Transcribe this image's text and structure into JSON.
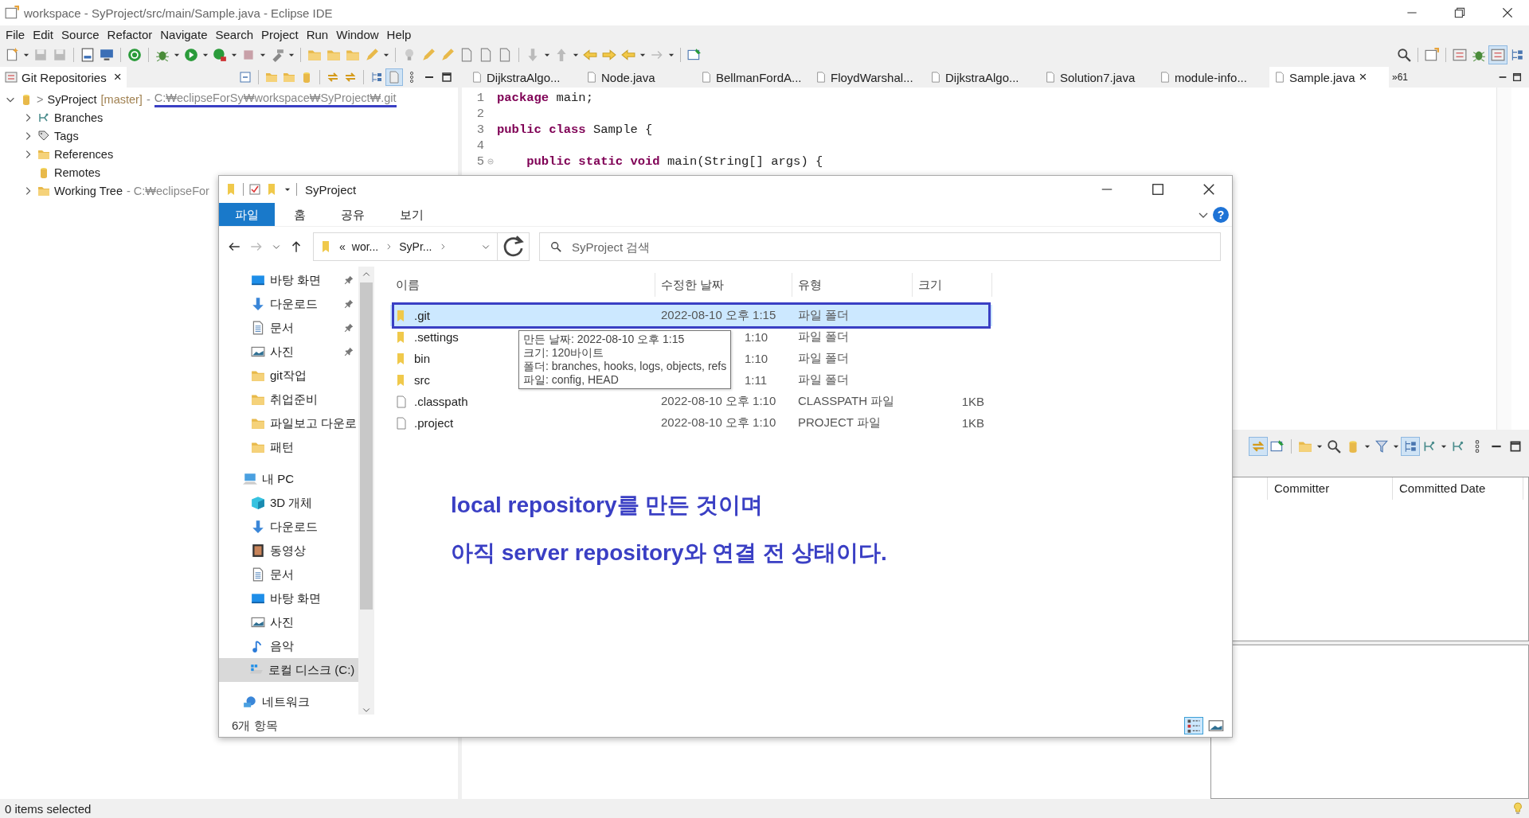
{
  "window": {
    "title": "workspace - SyProject/src/main/Sample.java - Eclipse IDE"
  },
  "menu": [
    "File",
    "Edit",
    "Source",
    "Refactor",
    "Navigate",
    "Search",
    "Project",
    "Run",
    "Window",
    "Help"
  ],
  "git_view": {
    "tab": "Git Repositories",
    "close": "×",
    "repository": {
      "name": "SyProject",
      "dirty_mark": ">",
      "branch": "[master]",
      "separator": "-",
      "path": "C:₩eclipseForSy₩workspace₩SyProject₩.git",
      "expanded": true,
      "path_underlined": true,
      "children": [
        {
          "label": "Branches",
          "kind": "branches",
          "expandable": true
        },
        {
          "label": "Tags",
          "kind": "tags",
          "expandable": true
        },
        {
          "label": "References",
          "kind": "folder",
          "expandable": true
        },
        {
          "label": "Remotes",
          "kind": "remotes",
          "expandable": false
        },
        {
          "label": "Working Tree",
          "kind": "folder",
          "expandable": true,
          "path": "- C:₩eclipseFor"
        }
      ]
    }
  },
  "editor": {
    "tabs": [
      {
        "label": "DijkstraAlgo...",
        "selected": false
      },
      {
        "label": "Node.java",
        "selected": false
      },
      {
        "label": "BellmanFordA...",
        "selected": false
      },
      {
        "label": "FloydWarshal...",
        "selected": false
      },
      {
        "label": "DijkstraAlgo...",
        "selected": false
      },
      {
        "label": "Solution7.java",
        "selected": false
      },
      {
        "label": "module-info...",
        "selected": false
      },
      {
        "label": "Sample.java",
        "selected": true,
        "close": "×"
      }
    ],
    "overflow": "»61",
    "lines": [
      {
        "number": "1",
        "code": "**package** main;",
        "foldable": false
      },
      {
        "number": "2",
        "foldable": false
      },
      {
        "number": "3",
        "code": "**public** **class** Sample {",
        "foldable": false
      },
      {
        "number": "4",
        "foldable": false
      },
      {
        "number": "5",
        "code": "    **public** **static** **void** main(String[] args) {",
        "foldable": true
      }
    ]
  },
  "history": {
    "columns": [
      "Committer",
      "Committed Date"
    ]
  },
  "explorer": {
    "title": "SyProject",
    "ribbon_tabs": [
      {
        "label": "파일",
        "selected": true
      },
      {
        "label": "홈",
        "selected": false
      },
      {
        "label": "공유",
        "selected": false
      },
      {
        "label": "보기",
        "selected": false
      }
    ],
    "help": "?",
    "breadcrumb": {
      "overflow": "«",
      "crumbs": [
        "wor...",
        "SyPr..."
      ]
    },
    "search": {
      "placeholder": "SyProject 검색"
    },
    "quick_access": [
      {
        "label": "바탕 화면",
        "kind": "desktop",
        "pinned": true
      },
      {
        "label": "다운로드",
        "kind": "download",
        "pinned": true
      },
      {
        "label": "문서",
        "kind": "document",
        "pinned": true
      },
      {
        "label": "사진",
        "kind": "picture",
        "pinned": true
      },
      {
        "label": "git작업",
        "kind": "folder",
        "pinned": false
      },
      {
        "label": "취업준비",
        "kind": "folder",
        "pinned": false
      },
      {
        "label": "파일보고 다운로",
        "kind": "folder",
        "pinned": false
      },
      {
        "label": "패턴",
        "kind": "folder",
        "pinned": false
      }
    ],
    "this_pc": {
      "label": "내 PC",
      "children": [
        {
          "label": "3D 개체",
          "kind": "cube",
          "selected": false
        },
        {
          "label": "다운로드",
          "kind": "download",
          "selected": false
        },
        {
          "label": "동영상",
          "kind": "video",
          "selected": false
        },
        {
          "label": "문서",
          "kind": "document",
          "selected": false
        },
        {
          "label": "바탕 화면",
          "kind": "desktop",
          "selected": false
        },
        {
          "label": "사진",
          "kind": "picture",
          "selected": false
        },
        {
          "label": "음악",
          "kind": "music",
          "selected": false
        },
        {
          "label": "로컬 디스크 (C:)",
          "kind": "drive",
          "selected": true
        }
      ]
    },
    "network": {
      "label": "네트워크"
    },
    "columns": [
      "이름",
      "수정한 날짜",
      "유형",
      "크기"
    ],
    "rows": [
      {
        "name": ".git",
        "kind": "folder",
        "modified": "2022-08-10 오후 1:15",
        "type": "파일 폴더",
        "selected": true,
        "boxed": true
      },
      {
        "name": ".settings",
        "kind": "folder",
        "modified": "1:10",
        "modified_cut": true,
        "type": "파일 폴더",
        "selected": false,
        "boxed": false
      },
      {
        "name": "bin",
        "kind": "folder",
        "modified": "1:10",
        "modified_cut": true,
        "type": "파일 폴더",
        "selected": false,
        "boxed": false
      },
      {
        "name": "src",
        "kind": "folder",
        "modified": "1:11",
        "modified_cut": true,
        "type": "파일 폴더",
        "selected": false,
        "boxed": false
      },
      {
        "name": ".classpath",
        "kind": "file",
        "modified": "2022-08-10 오후 1:10",
        "type": "CLASSPATH 파일",
        "size": "1KB",
        "selected": false,
        "boxed": false
      },
      {
        "name": ".project",
        "kind": "file",
        "modified": "2022-08-10 오후 1:10",
        "type": "PROJECT 파일",
        "size": "1KB",
        "selected": false,
        "boxed": false
      }
    ],
    "tooltip": [
      "만든 날짜: 2022-08-10 오후 1:15",
      "크기: 120바이트",
      "폴더: branches, hooks, logs, objects, refs",
      "파일: config, HEAD"
    ],
    "status": "6개 항목",
    "view_buttons": [
      {
        "kind": "details",
        "selected": true
      },
      {
        "kind": "thumbnails",
        "selected": false
      }
    ]
  },
  "annotation": [
    "local repository를 만든 것이며",
    "아직 server repository와 연결 전 상태이다."
  ],
  "status_bar": {
    "text": "0 items selected"
  }
}
